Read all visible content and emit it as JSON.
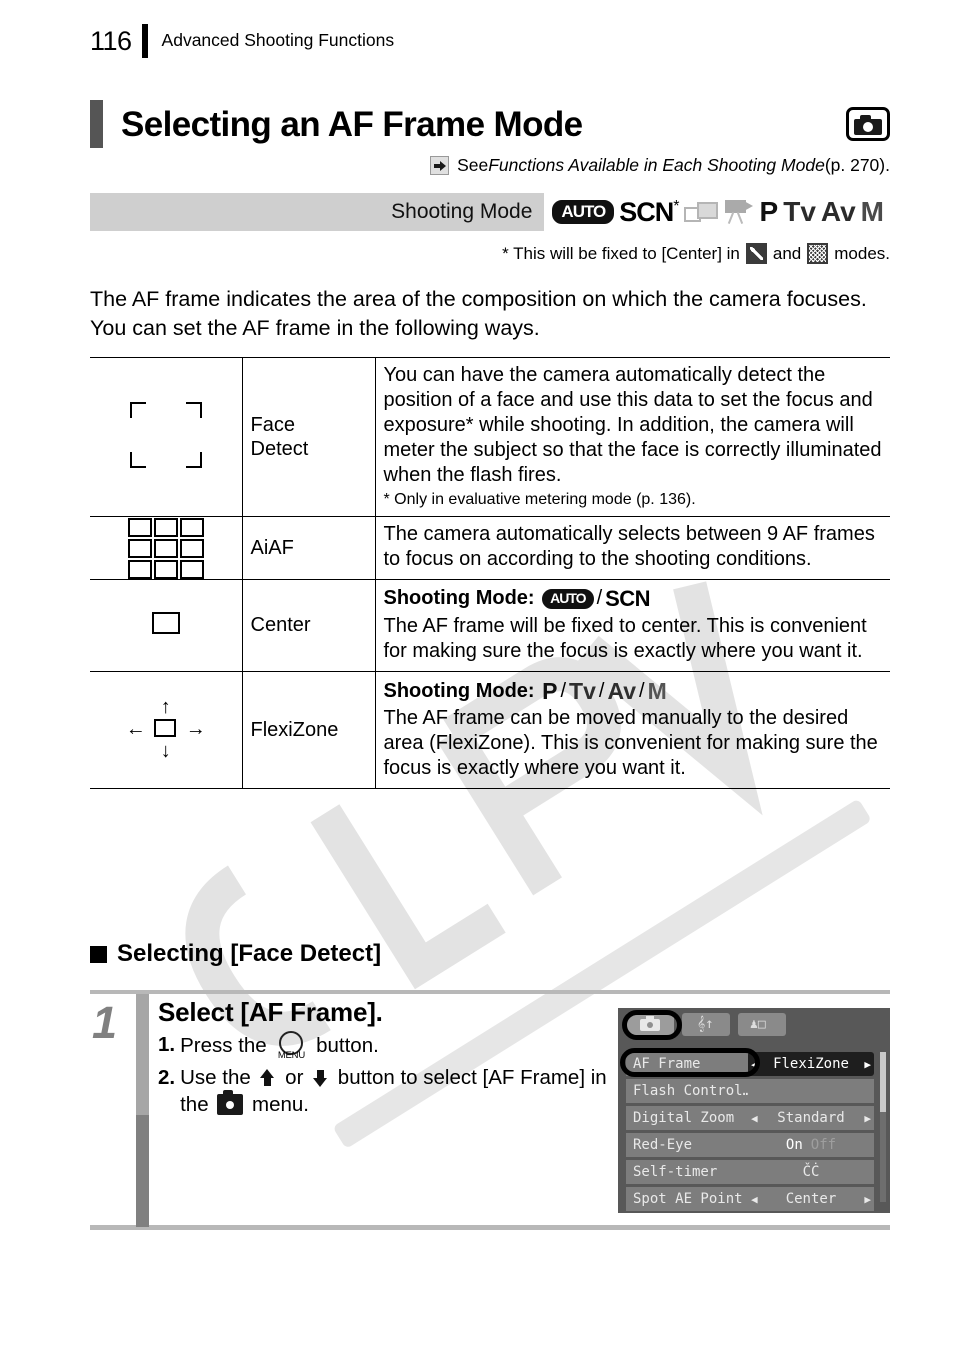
{
  "header": {
    "page_number": "116",
    "section_title": "Advanced Shooting Functions"
  },
  "title": {
    "text": "Selecting an AF Frame Mode",
    "icon": "camera-icon"
  },
  "see_also": {
    "prefix": "See ",
    "italic": "Functions Available in Each Shooting Mode",
    "suffix": " (p. 270).",
    "icon": "arrow-right-icon"
  },
  "shooting_mode_band": {
    "label": "Shooting Mode",
    "modes": [
      "AUTO",
      "SCN",
      "stitch-assist-icon",
      "movie-icon",
      "P",
      "Tv",
      "Av",
      "M"
    ],
    "scn_asterisk": "*"
  },
  "band_footnote": {
    "text_before": "* This will be fixed to [Center] in ",
    "icon1": "fireworks-mode-icon",
    "text_middle": " and ",
    "icon2": "underwater-mode-icon",
    "text_after": " modes."
  },
  "intro": "The AF frame indicates the area of the composition on which the camera focuses. You can set the AF frame in the following ways.",
  "table": {
    "rows": [
      {
        "icon": "face-detect-frame-icon",
        "name": "Face\nDetect",
        "description": "You can have the camera automatically detect the position of a face and use this data to set the focus and exposure* while shooting. In addition, the camera will meter the subject so that the face is correctly illuminated when the flash fires.",
        "note": "*  Only in evaluative metering mode (p. 136).",
        "mode_head": null
      },
      {
        "icon": "aiaf-grid-icon",
        "name": "AiAF",
        "description": "The camera automatically selects between 9 AF frames to focus on according to the shooting conditions.",
        "note": null,
        "mode_head": null
      },
      {
        "icon": "center-frame-icon",
        "name": "Center",
        "description": "The AF frame will be fixed to center. This is convenient for making sure the focus is exactly where you want it.",
        "note": null,
        "mode_head": {
          "label": "Shooting Mode:",
          "modes": [
            "AUTO",
            "SCN"
          ]
        }
      },
      {
        "icon": "flexizone-arrows-icon",
        "name": "FlexiZone",
        "description": "The AF frame can be moved manually to the desired area (FlexiZone). This is convenient for making sure the focus is exactly where you want it.",
        "note": null,
        "mode_head": {
          "label": "Shooting Mode:",
          "modes": [
            "P",
            "Tv",
            "Av",
            "M"
          ]
        }
      }
    ]
  },
  "section_heading": "Selecting [Face Detect]",
  "step": {
    "number": "1",
    "title": "Select [AF Frame].",
    "substeps": [
      {
        "number": "1.",
        "text_before": "Press the ",
        "icon": "menu-button-icon",
        "icon_label": "MENU",
        "text_after": " button."
      },
      {
        "number": "2.",
        "text_before": "Use the ",
        "icon_up": "up-arrow-icon",
        "text_middle_1": " or ",
        "icon_down": "down-arrow-icon",
        "text_middle_2": " button to select [AF Frame] in the ",
        "icon_menu": "camera-menu-icon",
        "text_after": " menu."
      }
    ]
  },
  "lcd": {
    "tabs": [
      {
        "name": "shooting-tab",
        "icon": "camera-icon",
        "active": true
      },
      {
        "name": "setup-tab",
        "icon": "tools-icon",
        "active": false
      },
      {
        "name": "my-camera-tab",
        "icon": "my-camera-icon",
        "active": false
      }
    ],
    "rows": [
      {
        "label": "AF Frame",
        "value": "FlexiZone",
        "selected": true,
        "arrows": true,
        "type": "value"
      },
      {
        "label": "Flash Control…",
        "value": "",
        "selected": false,
        "arrows": false,
        "type": "plain"
      },
      {
        "label": "Digital Zoom",
        "value": "Standard",
        "selected": false,
        "arrows": true,
        "type": "value"
      },
      {
        "label": "Red-Eye",
        "value": "On Off",
        "selected": false,
        "arrows": false,
        "type": "onoff",
        "on": "On",
        "off": "Off"
      },
      {
        "label": "Self-timer",
        "value": "ČĊ",
        "selected": false,
        "arrows": false,
        "type": "value"
      },
      {
        "label": "Spot AE Point",
        "value": "Center",
        "selected": false,
        "arrows": true,
        "type": "value"
      }
    ],
    "highlight_tab": "shooting-tab-highlight",
    "highlight_item": "af-frame-row-highlight"
  },
  "colors": {
    "band_background": "#cfcfcf",
    "title_bar": "#555555",
    "step_number": "#808080",
    "lcd_background": "#585858",
    "lcd_row": "#7d7d7d",
    "lcd_selected": "#1e1e1e"
  }
}
